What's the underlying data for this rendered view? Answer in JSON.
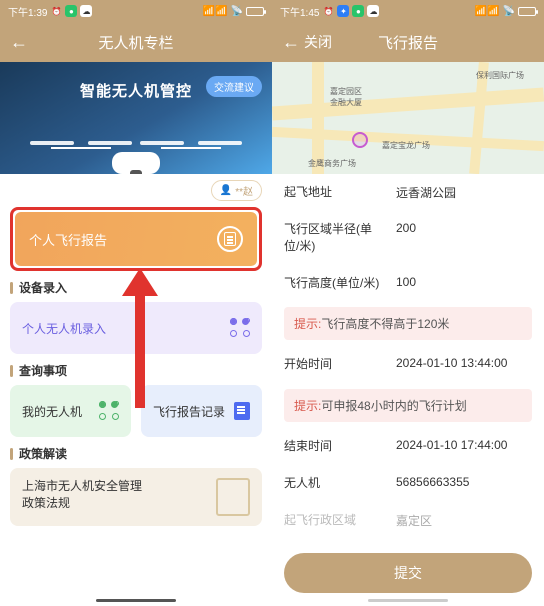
{
  "left": {
    "status": {
      "time": "下午1:39",
      "icons": [
        "alarm",
        "weather",
        "chat"
      ]
    },
    "header": {
      "title": "无人机专栏"
    },
    "banner": {
      "title": "智能无人机管控",
      "button": "交流建议"
    },
    "chip": "**赵",
    "personal_report": {
      "label": "个人飞行报告"
    },
    "sections": {
      "entry": {
        "heading": "设备录入",
        "card": "个人无人机录入"
      },
      "query": {
        "heading": "查询事项",
        "card1": "我的无人机",
        "card2": "飞行报告记录"
      },
      "policy": {
        "heading": "政策解读",
        "card": "上海市无人机安全管理\n政策法规"
      }
    }
  },
  "right": {
    "status": {
      "time": "下午1:45",
      "icons": [
        "alarm",
        "chat",
        "weather"
      ]
    },
    "header": {
      "close": "关闭",
      "title": "飞行报告"
    },
    "map_pois": {
      "a": "保利国际广场",
      "b": "嘉定园区\n金融大厦",
      "c": "嘉定宝龙广场",
      "d": "金鹰商务广场"
    },
    "form": {
      "addr_label": "起飞地址",
      "addr_value": "远香湖公园",
      "radius_label": "飞行区域半径(单位/米)",
      "radius_value": "200",
      "alt_label": "飞行高度(单位/米)",
      "alt_value": "100",
      "tip1_prefix": "提示:",
      "tip1_text": "飞行高度不得高于120米",
      "start_label": "开始时间",
      "start_value": "2024-01-10 13:44:00",
      "tip2_prefix": "提示:",
      "tip2_text": "可申报48小时内的飞行计划",
      "end_label": "结束时间",
      "end_value": "2024-01-10 17:44:00",
      "drone_label": "无人机",
      "drone_value": "56856663355",
      "region_label": "起飞行政区域",
      "region_value": "嘉定区",
      "submit": "提交"
    }
  }
}
